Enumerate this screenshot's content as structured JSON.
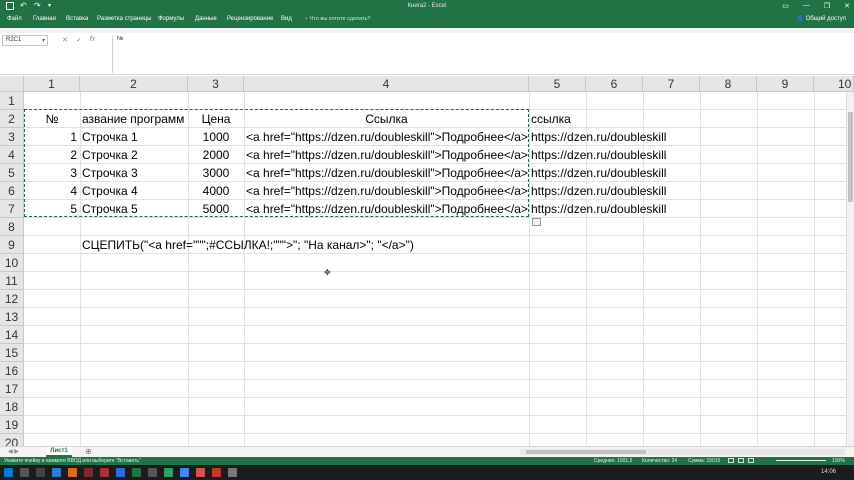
{
  "titlebar": {
    "title": "Книга2 - Excel",
    "colors": {
      "brand": "#217346"
    }
  },
  "ribbon": {
    "tabs": [
      "Файл",
      "Главная",
      "Вставка",
      "Разметка страницы",
      "Формулы",
      "Данные",
      "Рецензирование",
      "Вид"
    ],
    "tell_me": "Что вы хотите сделать?",
    "share": "Общий доступ"
  },
  "formula_bar": {
    "name_box": "R2C1",
    "content": "№"
  },
  "columns": [
    "1",
    "2",
    "3",
    "4",
    "5",
    "6",
    "7",
    "8",
    "9",
    "10"
  ],
  "rows": [
    "1",
    "2",
    "3",
    "4",
    "5",
    "6",
    "7",
    "8",
    "9",
    "10",
    "11",
    "12",
    "13",
    "14",
    "15",
    "16",
    "17",
    "18",
    "19",
    "20"
  ],
  "cells": {
    "header_no": "№",
    "header_name": "азвание программ",
    "header_price": "Цена",
    "header_link": "Ссылка",
    "header_link2": "ссылка",
    "data": [
      {
        "no": "1",
        "name": "Строчка 1",
        "price": "1000",
        "link": "<a href=\"https://dzen.ru/doubleskill\">Подробнее</a>",
        "url": "https://dzen.ru/doubleskill"
      },
      {
        "no": "2",
        "name": "Строчка 2",
        "price": "2000",
        "link": "<a href=\"https://dzen.ru/doubleskill\">Подробнее</a>",
        "url": "https://dzen.ru/doubleskill"
      },
      {
        "no": "3",
        "name": "Строчка 3",
        "price": "3000",
        "link": "<a href=\"https://dzen.ru/doubleskill\">Подробнее</a>",
        "url": "https://dzen.ru/doubleskill"
      },
      {
        "no": "4",
        "name": "Строчка 4",
        "price": "4000",
        "link": "<a href=\"https://dzen.ru/doubleskill\">Подробнее</a>",
        "url": "https://dzen.ru/doubleskill"
      },
      {
        "no": "5",
        "name": "Строчка 5",
        "price": "5000",
        "link": "<a href=\"https://dzen.ru/doubleskill\">Подробнее</a>",
        "url": "https://dzen.ru/doubleskill"
      }
    ],
    "formula_text": "СЦЕПИТЬ(\"<a href=\"\"\";#ССЫЛКА!;\"\"\">\"; \"На канал>\"; \"</a>\")"
  },
  "sheets": {
    "active": "Лист1"
  },
  "status": {
    "message": "Укажите ячейку и нажмите ВВОД или выберите \"Вставить\"",
    "average": "Среднее: 1501,5",
    "count": "Количество: 24",
    "sum": "Сумма: 15015",
    "zoom": "100%"
  },
  "taskbar": {
    "time": "14:06"
  }
}
